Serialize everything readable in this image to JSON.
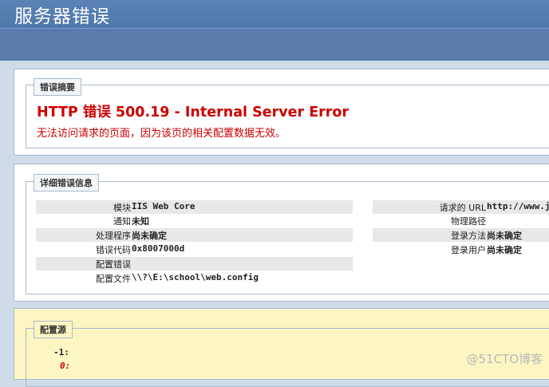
{
  "header": {
    "title": "服务器错误"
  },
  "summary": {
    "legend": "错误摘要",
    "title": "HTTP 错误 500.19 - Internal Server Error",
    "description": "无法访问请求的页面，因为该页的相关配置数据无效。"
  },
  "details": {
    "legend": "详细错误信息",
    "left": [
      {
        "label": "模块",
        "value": "IIS Web Core"
      },
      {
        "label": "通知",
        "value": "未知"
      },
      {
        "label": "处理程序",
        "value": "尚未确定"
      },
      {
        "label": "错误代码",
        "value": "0x8007000d"
      },
      {
        "label": "配置错误",
        "value": ""
      },
      {
        "label": "配置文件",
        "value": "\\\\?\\E:\\school\\web.config"
      }
    ],
    "right": [
      {
        "label": "请求的 URL",
        "value": "http://www.j"
      },
      {
        "label": "物理路径",
        "value": ""
      },
      {
        "label": "登录方法",
        "value": "尚未确定"
      },
      {
        "label": "登录用户",
        "value": "尚未确定"
      }
    ]
  },
  "config_source": {
    "legend": "配置源",
    "lines": [
      {
        "num": "-1:",
        "color": "#222222"
      },
      {
        "num": "0:",
        "color": "#cc0000"
      }
    ]
  },
  "watermark": "@51CTO博客"
}
